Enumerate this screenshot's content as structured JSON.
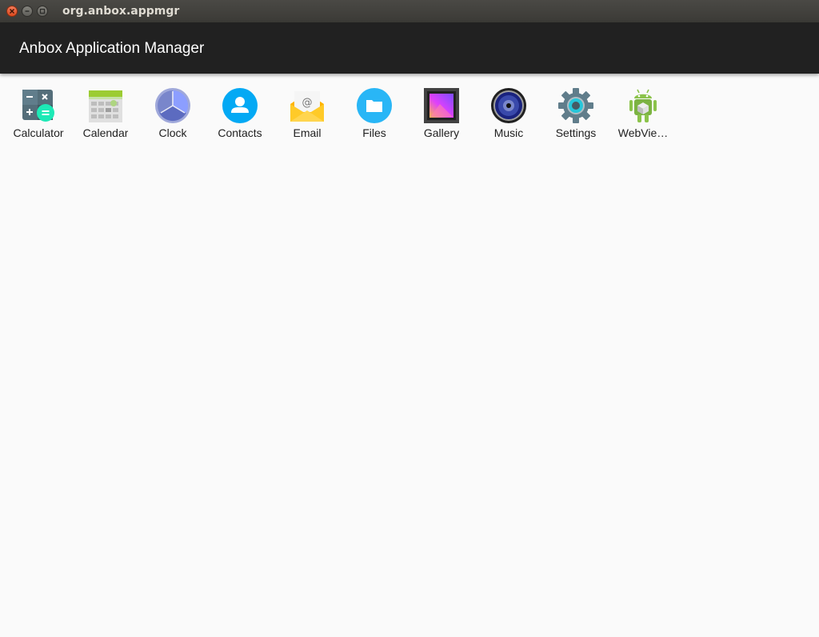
{
  "window": {
    "title": "org.anbox.appmgr"
  },
  "appbar": {
    "title": "Anbox Application Manager"
  },
  "apps": [
    {
      "label": "Calculator",
      "icon": "calculator-icon"
    },
    {
      "label": "Calendar",
      "icon": "calendar-icon"
    },
    {
      "label": "Clock",
      "icon": "clock-icon"
    },
    {
      "label": "Contacts",
      "icon": "contacts-icon"
    },
    {
      "label": "Email",
      "icon": "email-icon"
    },
    {
      "label": "Files",
      "icon": "files-icon"
    },
    {
      "label": "Gallery",
      "icon": "gallery-icon"
    },
    {
      "label": "Music",
      "icon": "music-icon"
    },
    {
      "label": "Settings",
      "icon": "settings-icon"
    },
    {
      "label": "WebVie…",
      "icon": "android-icon"
    }
  ]
}
